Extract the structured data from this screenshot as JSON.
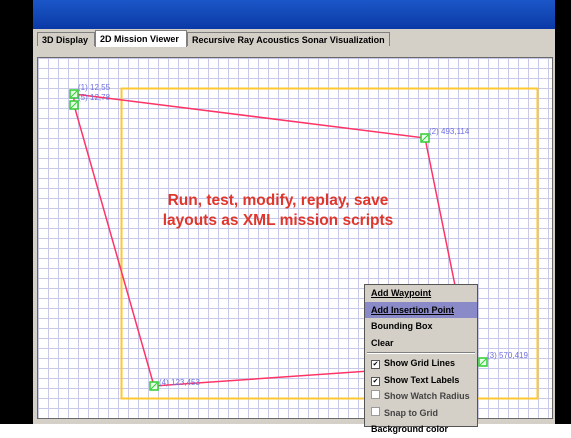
{
  "tabs": [
    {
      "label": "3D Display"
    },
    {
      "label": "2D Mission Viewer"
    },
    {
      "label": "Recursive Ray Acoustics Sonar Visualization"
    }
  ],
  "waypoints": [
    {
      "label": "(1) 12,55"
    },
    {
      "label": "(5) 12,78"
    },
    {
      "label": "(2) 493,114"
    },
    {
      "label": "(3) 570,419"
    },
    {
      "label": "(4) 123,453"
    }
  ],
  "banner": {
    "line1": "Run, test, modify, replay, save",
    "line2": "layouts as XML mission scripts"
  },
  "context_menu": {
    "items": [
      {
        "label": "Add Waypoint"
      },
      {
        "label": "Add Insertion Point"
      },
      {
        "label": "Bounding Box"
      },
      {
        "label": "Clear"
      },
      {
        "label": "Show Grid Lines",
        "checked": true
      },
      {
        "label": "Show Text Labels",
        "checked": true
      },
      {
        "label": "Show Watch Radius",
        "checked": false
      },
      {
        "label": "Snap to Grid",
        "checked": false
      },
      {
        "label": "Background color"
      }
    ],
    "highlighted_index": 1
  },
  "colors": {
    "path": "#ff3366",
    "bounding_box": "#ffc830",
    "waypoint": "#33cc33",
    "label": "#6f6fe0",
    "banner": "#e0362a",
    "menu_highlight": "#8a8ac8"
  }
}
